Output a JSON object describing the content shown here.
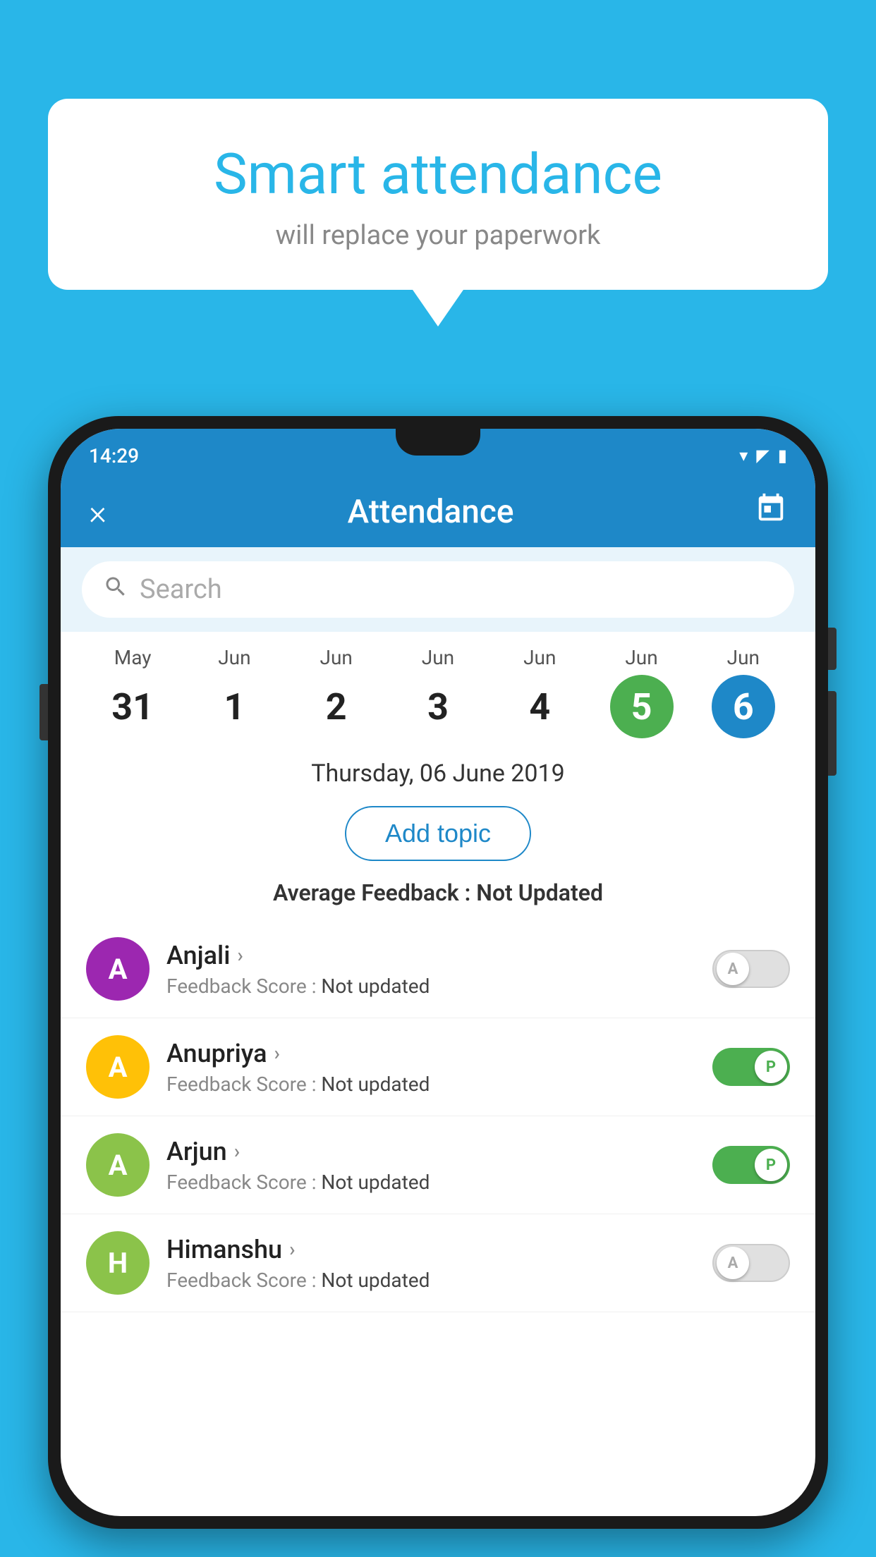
{
  "background_color": "#29b6e8",
  "speech_bubble": {
    "title": "Smart attendance",
    "subtitle": "will replace your paperwork"
  },
  "status_bar": {
    "time": "14:29",
    "icons": [
      "wifi",
      "signal",
      "battery"
    ]
  },
  "app_header": {
    "title": "Attendance",
    "close_label": "×",
    "calendar_icon": "📅"
  },
  "search": {
    "placeholder": "Search"
  },
  "calendar": {
    "days": [
      {
        "month": "May",
        "number": "31",
        "state": "normal"
      },
      {
        "month": "Jun",
        "number": "1",
        "state": "normal"
      },
      {
        "month": "Jun",
        "number": "2",
        "state": "normal"
      },
      {
        "month": "Jun",
        "number": "3",
        "state": "normal"
      },
      {
        "month": "Jun",
        "number": "4",
        "state": "normal"
      },
      {
        "month": "Jun",
        "number": "5",
        "state": "today"
      },
      {
        "month": "Jun",
        "number": "6",
        "state": "selected"
      }
    ]
  },
  "selected_date": "Thursday, 06 June 2019",
  "add_topic_label": "Add topic",
  "avg_feedback_label": "Average Feedback :",
  "avg_feedback_value": "Not Updated",
  "students": [
    {
      "name": "Anjali",
      "avatar_letter": "A",
      "avatar_color": "#9c27b0",
      "feedback_label": "Feedback Score :",
      "feedback_value": "Not updated",
      "toggle_state": "off",
      "toggle_label": "A"
    },
    {
      "name": "Anupriya",
      "avatar_letter": "A",
      "avatar_color": "#ffc107",
      "feedback_label": "Feedback Score :",
      "feedback_value": "Not updated",
      "toggle_state": "on",
      "toggle_label": "P"
    },
    {
      "name": "Arjun",
      "avatar_letter": "A",
      "avatar_color": "#8bc34a",
      "feedback_label": "Feedback Score :",
      "feedback_value": "Not updated",
      "toggle_state": "on",
      "toggle_label": "P"
    },
    {
      "name": "Himanshu",
      "avatar_letter": "H",
      "avatar_color": "#8bc34a",
      "feedback_label": "Feedback Score :",
      "feedback_value": "Not updated",
      "toggle_state": "off",
      "toggle_label": "A"
    }
  ]
}
